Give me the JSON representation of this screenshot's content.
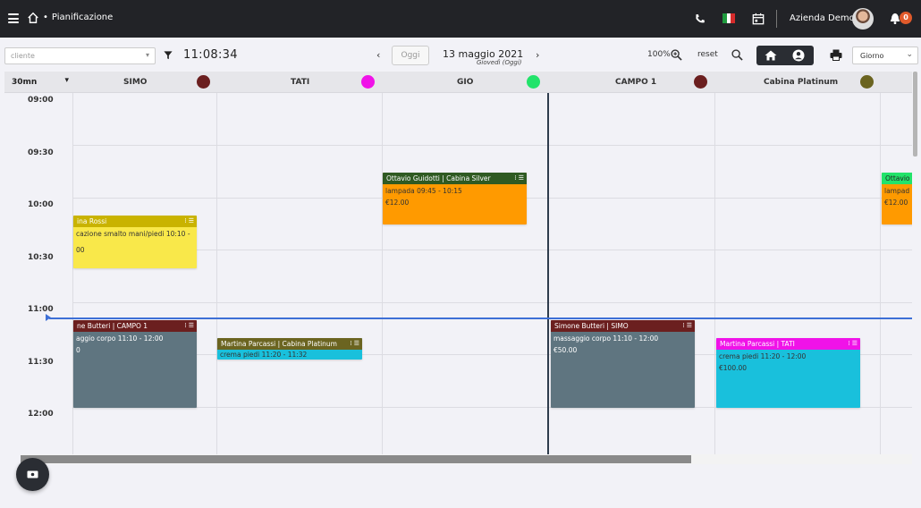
{
  "topbar": {
    "breadcrumb_sep": "•",
    "page_title": "Pianificazione",
    "company": "Azienda Demo",
    "notification_count": "0"
  },
  "toolbar": {
    "client_placeholder": "cliente",
    "clock": "11:08:34",
    "today_label": "Oggi",
    "date_main": "13 maggio 2021",
    "date_sub": "Giovedì (Oggi)",
    "zoom": "100%",
    "reset_label": "reset",
    "view_select": "Giorno"
  },
  "calendar": {
    "slot_select": "30mn",
    "columns": [
      {
        "name": "SIMO",
        "color": "#6b1f1f"
      },
      {
        "name": "TATI",
        "color": "#f012e8"
      },
      {
        "name": "GIO",
        "color": "#22e36a"
      },
      {
        "name": "CAMPO 1",
        "color": "#6b1f1f"
      },
      {
        "name": "Cabina Platinum",
        "color": "#6b6420"
      }
    ],
    "times": [
      "09:00",
      "09:30",
      "10:00",
      "10:30",
      "11:00",
      "11:30",
      "12:00"
    ],
    "current_time": "11:08",
    "appointments": [
      {
        "title": "Ottavio Guidotti | Cabina Silver",
        "service": "lampada 09:45 - 10:15",
        "price": "€12.00",
        "head_color": "#2f5a22",
        "body_color": "#ff9a00"
      },
      {
        "title": "ina Rossi",
        "service": "cazione smalto mani/piedi 10:10 -",
        "price": "00",
        "head_color": "#c9b300",
        "body_color": "#f9e84a"
      },
      {
        "title": "ne Butteri | CAMPO 1",
        "service": "aggio corpo 11:10 - 12:00",
        "price": "0",
        "head_color": "#6b1f1f",
        "body_color": "#5f7580"
      },
      {
        "title": "Martina Parcassi | Cabina Platinum",
        "service": "crema piedi 11:20 - 11:32",
        "price": "",
        "head_color": "#6b6420",
        "body_color": "#19c0dc"
      },
      {
        "title": "Simone Butteri | SIMO",
        "service": "massaggio corpo 11:10 - 12:00",
        "price": "€50.00",
        "head_color": "#6b1f1f",
        "body_color": "#5f7580"
      },
      {
        "title": "Martina Parcassi | TATI",
        "service": "crema piedi 11:20 - 12:00",
        "price": "€100.00",
        "head_color": "#f012e8",
        "body_color": "#19c0dc"
      },
      {
        "title": "Ottavio",
        "service": "lampad",
        "price": "€12.00",
        "head_color": "#22e36a",
        "body_color": "#ff9a00"
      }
    ]
  }
}
